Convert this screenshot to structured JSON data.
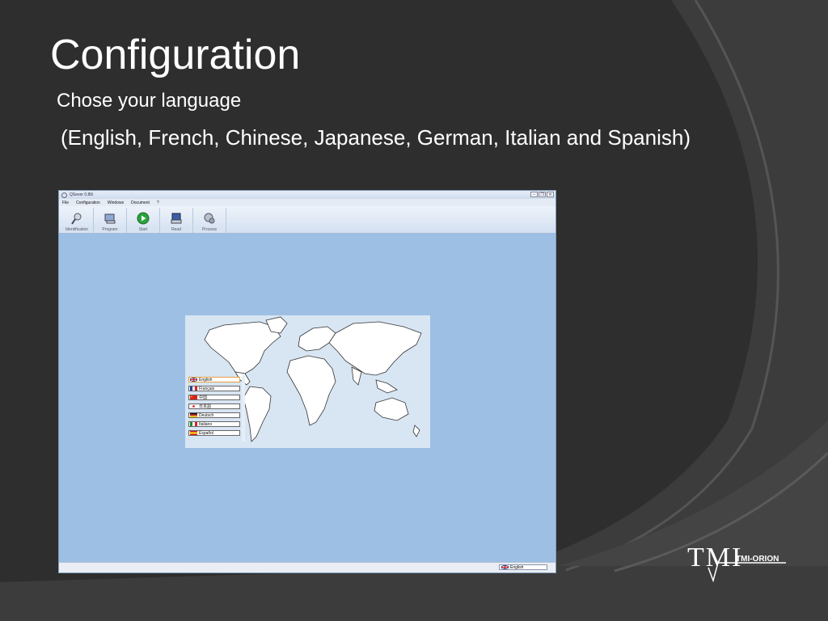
{
  "slide": {
    "title": "Configuration",
    "subtitle": "Chose your language",
    "languages_line": "(English, French, Chinese, Japanese, German, Italian and Spanish)"
  },
  "window": {
    "title": "QSever 0.86i",
    "menu": [
      "File",
      "Configuration",
      "Windows",
      "Document",
      "?"
    ],
    "toolbar": [
      {
        "label": "Identification",
        "icon": "identification-icon"
      },
      {
        "label": "Program",
        "icon": "program-icon"
      },
      {
        "label": "Start",
        "icon": "start-icon"
      },
      {
        "label": "Read",
        "icon": "read-icon"
      },
      {
        "label": "Process",
        "icon": "process-icon"
      }
    ],
    "status_language": "English"
  },
  "language_list": [
    {
      "label": "English",
      "flag": "flag-uk-icon",
      "selected": true
    },
    {
      "label": "Français",
      "flag": "flag-france-icon",
      "selected": false
    },
    {
      "label": "中国",
      "flag": "flag-china-icon",
      "selected": false
    },
    {
      "label": "日本語",
      "flag": "flag-japan-icon",
      "selected": false
    },
    {
      "label": "Deutsch",
      "flag": "flag-germany-icon",
      "selected": false
    },
    {
      "label": "Italiano",
      "flag": "flag-italy-icon",
      "selected": false
    },
    {
      "label": "Español",
      "flag": "flag-spain-icon",
      "selected": false
    }
  ],
  "logo": {
    "mark": "TMI",
    "text": "TMI-ORION"
  },
  "colors": {
    "background": "#2f2f2f",
    "window_bg": "#9dbfe4",
    "map_bg": "#d6e3f2"
  }
}
